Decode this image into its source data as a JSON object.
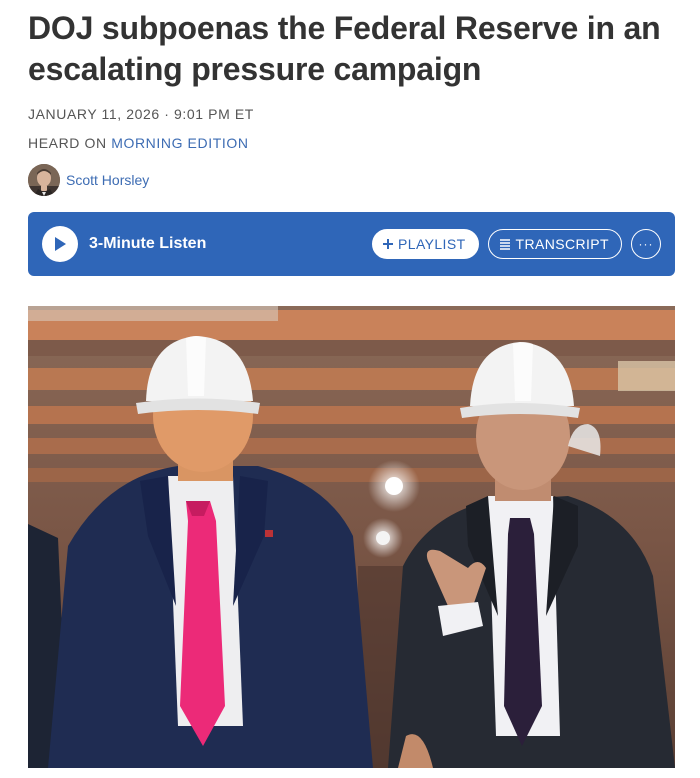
{
  "article": {
    "headline": "DOJ subpoenas the Federal Reserve in an escalating pressure campaign",
    "dateline": "JANUARY 11, 2026 · 9:01 PM ET",
    "heard_on_prefix": "HEARD ON",
    "show_name": "MORNING EDITION",
    "author": "Scott Horsley"
  },
  "player": {
    "listen_label": "3-Minute Listen",
    "playlist_label": "PLAYLIST",
    "transcript_label": "TRANSCRIPT",
    "more_label": "···",
    "icons": {
      "play": "play-icon",
      "playlist": "plus-icon",
      "transcript": "transcript-lines-icon",
      "more": "ellipsis-icon"
    }
  },
  "colors": {
    "accent": "#2f66b8",
    "link": "#3d6cb3",
    "headline": "#333333",
    "meta": "#555555"
  }
}
